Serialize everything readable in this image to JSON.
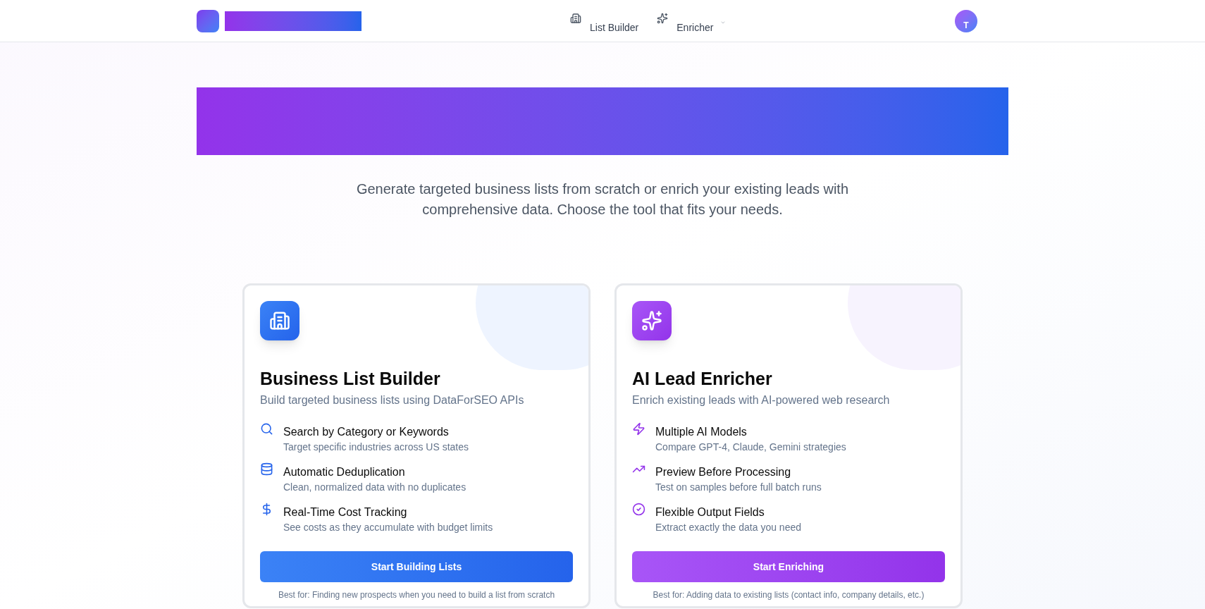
{
  "nav": [
    {
      "label": "List Builder",
      "kind": "builder",
      "has_menu": false
    },
    {
      "label": "Enricher",
      "kind": "enricher",
      "has_menu": true
    }
  ],
  "user": {
    "initial": "T"
  },
  "hero": {
    "subtitle": "Generate targeted business lists from scratch or enrich your existing leads with comprehensive data. Choose the tool that fits your needs."
  },
  "cards": [
    {
      "kind": "builder",
      "title": "Business List Builder",
      "subtitle": "Build targeted business lists using DataForSEO APIs",
      "features": [
        {
          "kind": "search",
          "title": "Search by Category or Keywords",
          "description": "Target specific industries across US states"
        },
        {
          "kind": "database",
          "title": "Automatic Deduplication",
          "description": "Clean, normalized data with no duplicates"
        },
        {
          "kind": "cost",
          "title": "Real-Time Cost Tracking",
          "description": "See costs as they accumulate with budget limits"
        }
      ],
      "button": "Start Building Lists",
      "best_for": "Best for: Finding new prospects when you need to build a list from scratch"
    },
    {
      "kind": "enricher",
      "title": "AI Lead Enricher",
      "subtitle": "Enrich existing leads with AI-powered web research",
      "features": [
        {
          "kind": "models",
          "title": "Multiple AI Models",
          "description": "Compare GPT-4, Claude, Gemini strategies"
        },
        {
          "kind": "preview",
          "title": "Preview Before Processing",
          "description": "Test on samples before full batch runs"
        },
        {
          "kind": "output",
          "title": "Flexible Output Fields",
          "description": "Extract exactly the data you need"
        }
      ],
      "button": "Start Enriching",
      "best_for": "Best for: Adding data to existing lists (contact info, company details, etc.)"
    }
  ]
}
